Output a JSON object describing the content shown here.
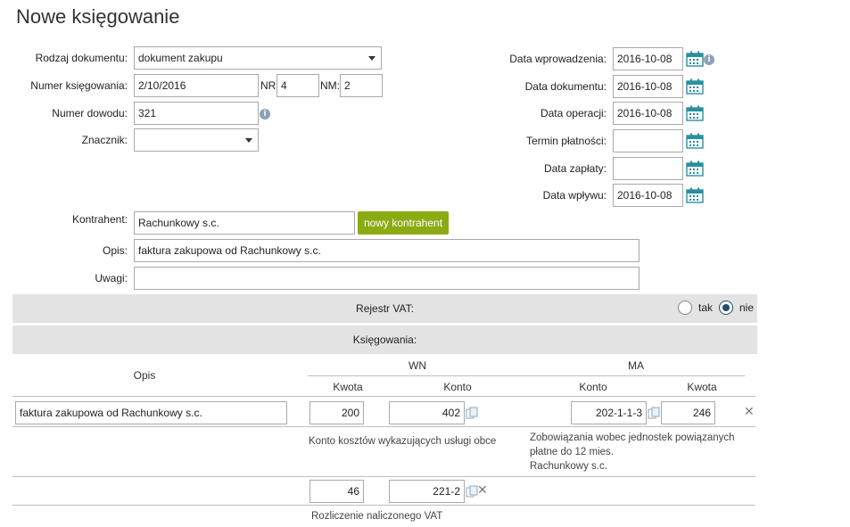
{
  "page": {
    "title": "Nowe księgowanie"
  },
  "form": {
    "rodzaj_label": "Rodzaj dokumentu:",
    "rodzaj_value": "dokument zakupu",
    "numer_ks_label": "Numer księgowania:",
    "numer_ks_value": "2/10/2016",
    "nr_label": "NR:",
    "nr_value": "4",
    "nm_label": "NM:",
    "nm_value": "2",
    "numer_dowodu_label": "Numer dowodu:",
    "numer_dowodu_value": "321",
    "znacznik_label": "Znacznik:",
    "znacznik_value": "",
    "kontrahent_label": "Kontrahent:",
    "kontrahent_value": "Rachunkowy s.c.",
    "nowy_kontrahent_label": "nowy kontrahent",
    "opis_label": "Opis:",
    "opis_value": "faktura zakupowa od Rachunkowy s.c.",
    "uwagi_label": "Uwagi:",
    "uwagi_value": ""
  },
  "dates": {
    "wprowadzenia_label": "Data wprowadzenia:",
    "wprowadzenia_value": "2016-10-08",
    "dokumentu_label": "Data dokumentu:",
    "dokumentu_value": "2016-10-08",
    "operacji_label": "Data operacji:",
    "operacji_value": "2016-10-08",
    "termin_label": "Termin płatności:",
    "termin_value": "",
    "zaplaty_label": "Data zapłaty:",
    "zaplaty_value": "",
    "wplywu_label": "Data wpływu:",
    "wplywu_value": "2016-10-08"
  },
  "vat": {
    "label": "Rejestr VAT:",
    "tak_label": "tak",
    "nie_label": "nie",
    "selected": "nie"
  },
  "ksiegowania": {
    "label": "Księgowania:",
    "col_opis": "Opis",
    "col_wn": "WN",
    "col_ma": "MA",
    "col_kwota": "Kwota",
    "col_konto": "Konto",
    "row1": {
      "opis": "faktura zakupowa od Rachunkowy s.c.",
      "wn_kwota": "200",
      "wn_konto": "402",
      "ma_konto": "202-1-1-3",
      "ma_kwota": "246",
      "wn_konto_desc": "Konto kosztów wykazujących usługi obce",
      "ma_konto_desc_1": "Zobowiązania wobec jednostek powiązanych",
      "ma_konto_desc_2": "płatne do 12 mies.",
      "ma_konto_desc_3": "Rachunkowy s.c."
    },
    "row2": {
      "wn_kwota": "46",
      "wn_konto": "221-2",
      "wn_konto_desc": "Rozliczenie naliczonego VAT"
    }
  },
  "colors": {
    "accent_green": "#8aac12",
    "calendar_teal": "#2b8fa0",
    "bar_gray": "#e3e3e3"
  }
}
